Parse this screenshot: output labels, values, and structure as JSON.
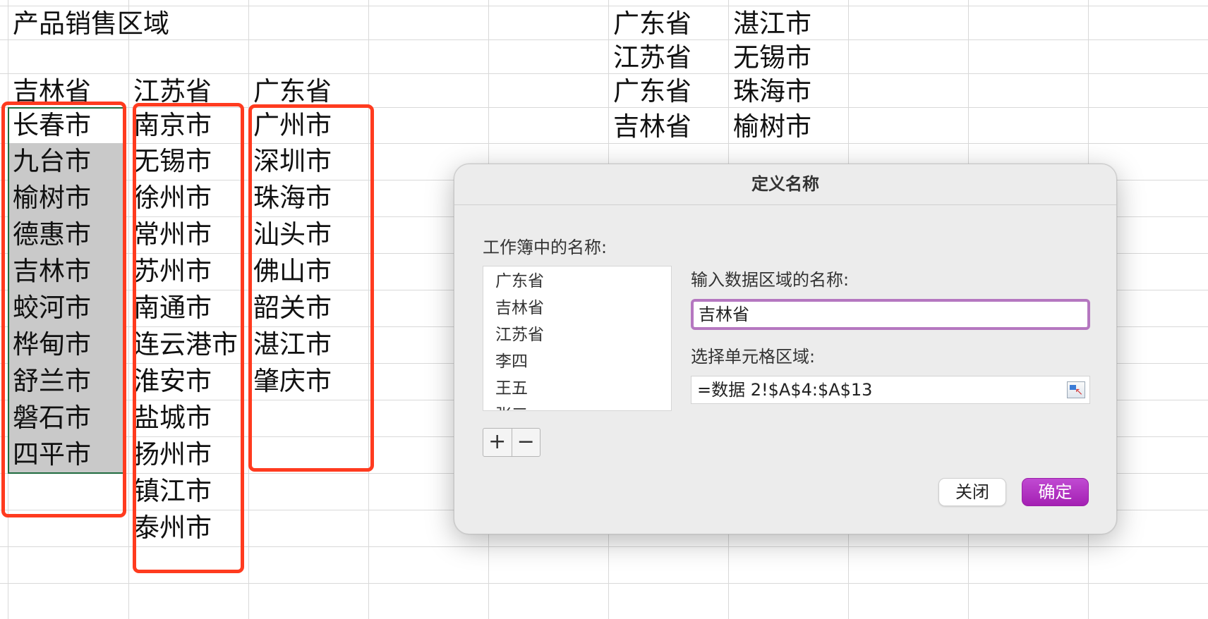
{
  "sheet": {
    "title": "产品销售区域",
    "headers": [
      "吉林省",
      "江苏省",
      "广东省"
    ],
    "col_a": [
      "长春市",
      "九台市",
      "榆树市",
      "德惠市",
      "吉林市",
      "蛟河市",
      "桦甸市",
      "舒兰市",
      "磐石市",
      "四平市"
    ],
    "col_b": [
      "南京市",
      "无锡市",
      "徐州市",
      "常州市",
      "苏州市",
      "南通市",
      "连云港市",
      "淮安市",
      "盐城市",
      "扬州市",
      "镇江市",
      "泰州市"
    ],
    "col_c": [
      "广州市",
      "深圳市",
      "珠海市",
      "汕头市",
      "佛山市",
      "韶关市",
      "湛江市",
      "肇庆市"
    ],
    "right_pairs": [
      [
        "广东省",
        "湛江市"
      ],
      [
        "江苏省",
        "无锡市"
      ],
      [
        "广东省",
        "珠海市"
      ],
      [
        "吉林省",
        "榆树市"
      ]
    ]
  },
  "dialog": {
    "title": "定义名称",
    "names_label": "工作簿中的名称:",
    "names": [
      "广东省",
      "吉林省",
      "江苏省",
      "李四",
      "王五",
      "张三"
    ],
    "add_label": "+",
    "remove_label": "−",
    "name_input_label": "输入数据区域的名称:",
    "name_value": "吉林省",
    "range_label": "选择单元格区域:",
    "range_value": "=数据 2!$A$4:$A$13",
    "close_label": "关闭",
    "ok_label": "确定"
  },
  "colors": {
    "highlight_box": "#ff3b1f",
    "selection_border": "#1f6b3f",
    "selection_fill": "#c9c9c9",
    "ok_button": "#b030c0"
  }
}
